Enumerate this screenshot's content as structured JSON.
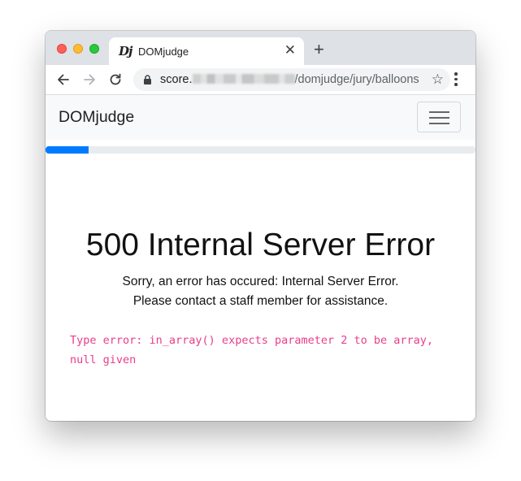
{
  "browser": {
    "tab": {
      "favicon_text": "Dj",
      "title": "DOMjudge"
    },
    "url": {
      "host_prefix": "score.",
      "path": "/domjudge/jury/balloons"
    },
    "icons": {
      "back": "arrow-left-icon",
      "forward": "arrow-right-icon",
      "reload": "reload-icon",
      "lock": "lock-icon",
      "star": "star-icon",
      "menu": "kebab-menu-icon",
      "close_tab": "close-icon",
      "new_tab": "plus-icon"
    }
  },
  "navbar": {
    "brand": "DOMjudge"
  },
  "progress": {
    "fraction": 0.1
  },
  "error": {
    "title": "500 Internal Server Error",
    "line1": "Sorry, an error has occured: Internal Server Error.",
    "line2": "Please contact a staff member for assistance.",
    "detail": "Type error: in_array() expects parameter 2 to be array, null given"
  },
  "colors": {
    "progress_fill": "#007bff",
    "error_detail": "#e83e8c",
    "navbar_bg": "#f8f9fa"
  }
}
